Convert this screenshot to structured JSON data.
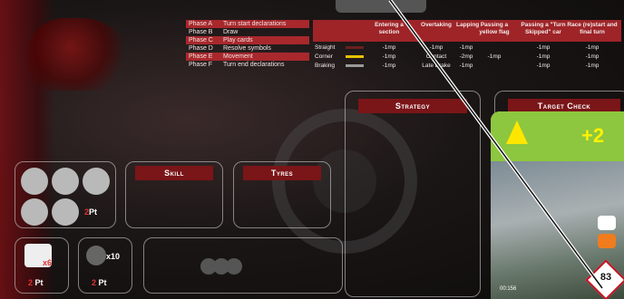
{
  "phases": [
    {
      "label": "Phase A",
      "desc": "Turn start declarations",
      "highlight": true
    },
    {
      "label": "Phase B",
      "desc": "Draw",
      "highlight": false
    },
    {
      "label": "Phase C",
      "desc": "Play cards",
      "highlight": true
    },
    {
      "label": "Phase D",
      "desc": "Resolve symbols",
      "highlight": false
    },
    {
      "label": "Phase E",
      "desc": "Movement",
      "highlight": true
    },
    {
      "label": "Phase F",
      "desc": "Turn end declarations",
      "highlight": false
    }
  ],
  "rules": {
    "headers": [
      "Entering a section",
      "Overtaking",
      "Lapping",
      "Passing a yellow flag",
      "Passing a \"Turn Skipped\" car",
      "Race (re)start and final turn"
    ],
    "rows": [
      {
        "label": "Straight",
        "color": "#6b1f1f",
        "values": [
          "-1mp",
          "-1mp",
          "-1mp",
          "",
          "-1mp",
          "-1mp"
        ]
      },
      {
        "label": "Corner",
        "color": "#e6c200",
        "values": [
          "-1mp",
          "Contact",
          "-2mp",
          "-1mp",
          "-1mp",
          "-1mp"
        ]
      },
      {
        "label": "Braking",
        "color": "#9a9a9a",
        "values": [
          "-1mp",
          "Late Brake",
          "-1mp",
          "",
          "-1mp",
          "-1mp"
        ]
      }
    ]
  },
  "tiles": {
    "strategy": "Strategy",
    "target_check": "Target Check",
    "skill": "Skill",
    "tyres": "Tyres"
  },
  "tokens": {
    "circle_pts": "Pt",
    "circle_pts_num": "2",
    "x6": "x6",
    "x10": "x10",
    "pt1": "Pt",
    "pt1_num": "2",
    "pt2": "Pt",
    "pt2_num": "2"
  },
  "card": {
    "bonus": "+2",
    "number": "83",
    "timer": "00:156"
  }
}
